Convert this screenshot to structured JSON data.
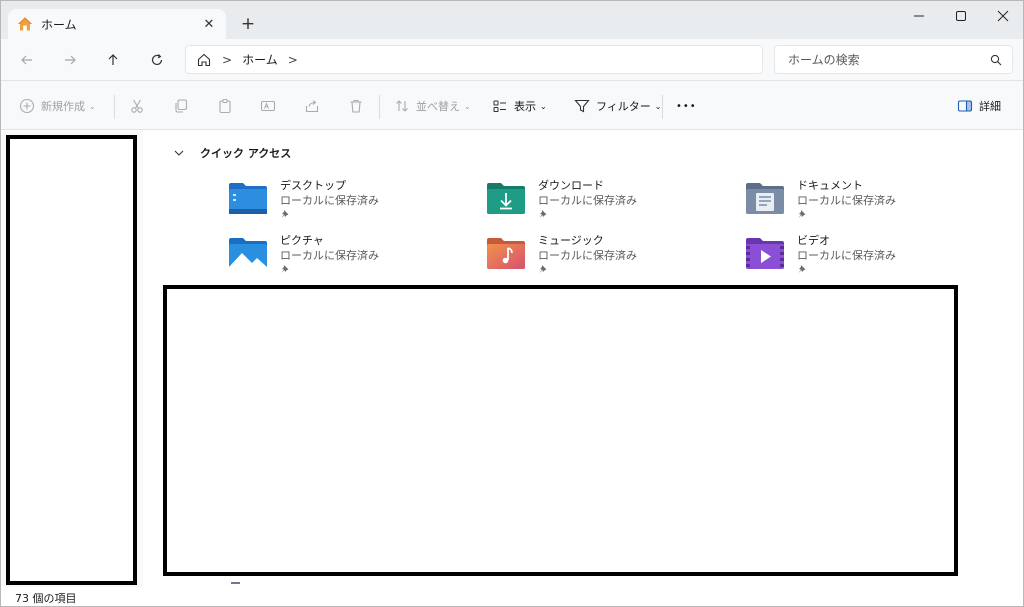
{
  "tab": {
    "title": "ホーム",
    "close": "✕",
    "new_tab": "+"
  },
  "window_controls": {
    "minimize": "—",
    "maximize": "☐",
    "close": "✕"
  },
  "address": {
    "crumbs": [
      "ホーム"
    ],
    "separator": ">"
  },
  "search": {
    "placeholder": "ホームの検索"
  },
  "commands": {
    "new": "新規作成",
    "sort": "並べ替え",
    "view": "表示",
    "filter": "フィルター",
    "more": "•••",
    "details": "詳細"
  },
  "quick_access": {
    "header": "クイック アクセス",
    "items": [
      {
        "name": "デスクトップ",
        "location": "ローカルに保存済み",
        "icon": "desktop-folder-icon",
        "color": "#2d8ee0"
      },
      {
        "name": "ダウンロード",
        "location": "ローカルに保存済み",
        "icon": "downloads-folder-icon",
        "color": "#1f9c86"
      },
      {
        "name": "ドキュメント",
        "location": "ローカルに保存済み",
        "icon": "documents-folder-icon",
        "color": "#7b8da6"
      },
      {
        "name": "ピクチャ",
        "location": "ローカルに保存済み",
        "icon": "pictures-folder-icon",
        "color": "#2a8fdf"
      },
      {
        "name": "ミュージック",
        "location": "ローカルに保存済み",
        "icon": "music-folder-icon",
        "color": "#e0675d"
      },
      {
        "name": "ビデオ",
        "location": "ローカルに保存済み",
        "icon": "videos-folder-icon",
        "color": "#8b4fd6"
      }
    ]
  },
  "status": {
    "item_count": "73 個の項目"
  }
}
